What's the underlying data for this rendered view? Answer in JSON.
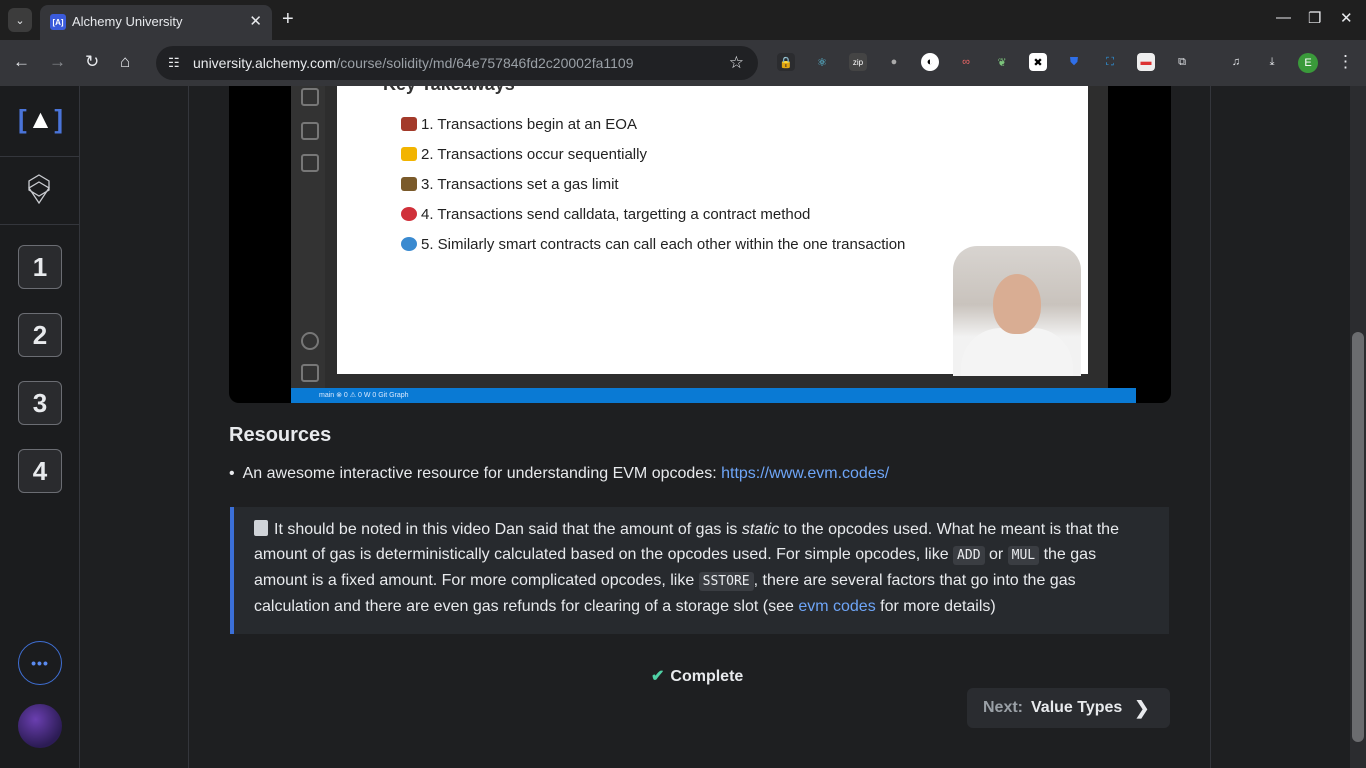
{
  "browser": {
    "tab_title": "Alchemy University",
    "tab_favicon": "[A]",
    "url_host": "university.alchemy.com",
    "url_path": "/course/solidity/md/64e757846fd2c20002fa1109",
    "profile_initial": "E"
  },
  "sidebar": {
    "logo": "[A]",
    "steps": [
      "1",
      "2",
      "3",
      "4"
    ],
    "more": "•••"
  },
  "video": {
    "heading": "Key Takeaways",
    "items": [
      "1. Transactions begin at an EOA",
      "2. Transactions occur sequentially",
      "3. Transactions set a gas limit",
      "4. Transactions send calldata, targetting a contract method",
      "5. Similarly smart contracts can call each other within the one transaction"
    ],
    "status_bar": "main  ⊗ 0 ⚠ 0  W 0  Git Graph"
  },
  "resources": {
    "heading": "Resources",
    "item_text": "An awesome interactive resource for understanding EVM opcodes: ",
    "item_link": "https://www.evm.codes/"
  },
  "note": {
    "t1": "It should be noted in this video Dan said that the amount of gas is ",
    "em": "static",
    "t2": " to the opcodes used. What he meant is that the amount of gas is deterministically calculated based on the opcodes used. For simple opcodes, like ",
    "code1": "ADD",
    "t3": " or ",
    "code2": "MUL",
    "t4": " the gas amount is a fixed amount. For more complicated opcodes, like ",
    "code3": "SSTORE",
    "t5": ", there are several factors that go into the gas calculation and there are even gas refunds for clearing of a storage slot (see ",
    "link": "evm codes",
    "t6": " for more details)"
  },
  "complete_label": "Complete",
  "next": {
    "prefix": "Next:",
    "title": "Value Types"
  },
  "colors": {
    "accent": "#3b6fd8",
    "link": "#6ea5f7",
    "check": "#4fd1a5"
  }
}
